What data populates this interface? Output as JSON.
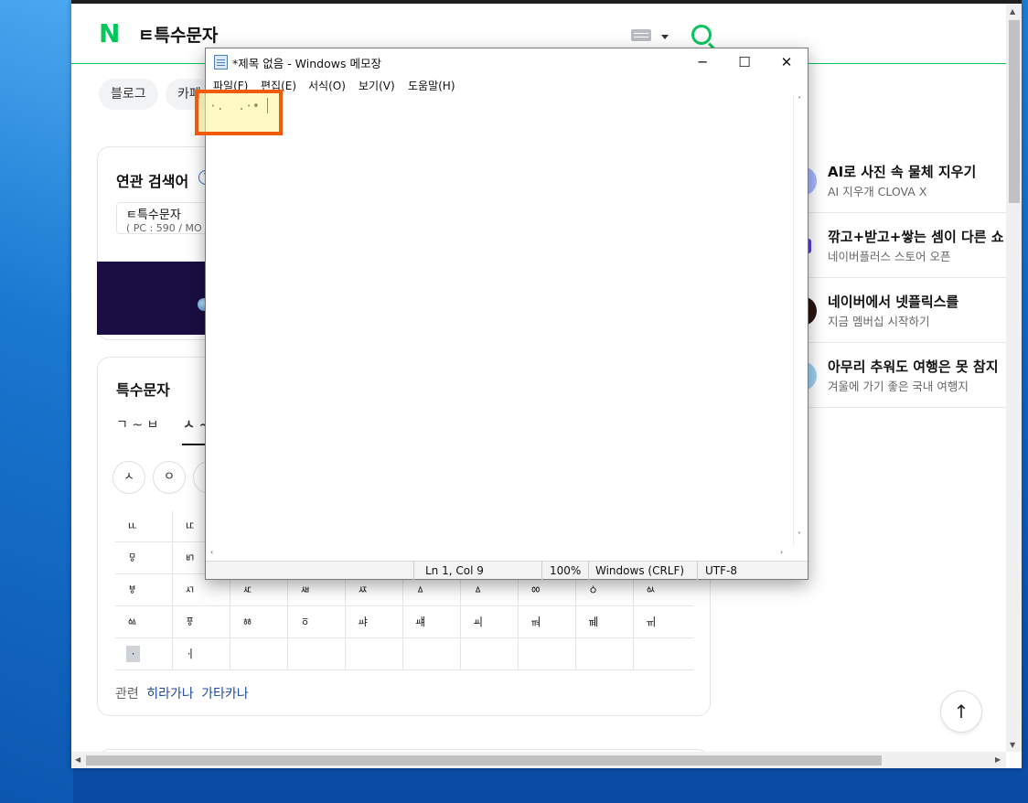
{
  "browser": {
    "query": "ㅌ특수문자",
    "tabs": [
      "블로그",
      "카페"
    ],
    "related": {
      "title": "연관 검색어",
      "help": "?",
      "keyword": "ㅌ특수문자",
      "count": "( PC : 590 / MO"
    },
    "special": {
      "title": "특수문자",
      "tabs": [
        "ㄱ ~ ㅂ",
        "ㅅ ~"
      ],
      "circles": [
        "ㅅ",
        "ㅇ"
      ],
      "grid": [
        [
          "ㅥ",
          "ㅦ",
          "",
          "",
          "",
          "",
          "",
          "",
          "",
          ""
        ],
        [
          "ㅱ",
          "ㅲ",
          "",
          "",
          "",
          "",
          "",
          "",
          "",
          ""
        ],
        [
          "ㅸ",
          "ㅺ",
          "ㅼ",
          "ㅽ",
          "ㅾ",
          "ㅿ",
          "ㅿ",
          "ㆀ",
          "ㆁ",
          "ㆂ"
        ],
        [
          "ㆃ",
          "ㆄ",
          "ㆅ",
          "ㆆ",
          "ㆇ",
          "ㆈ",
          "ㆉ",
          "ㆊ",
          "ㆋ",
          "ㆌ"
        ],
        [
          "ㆍ",
          "ㆎ",
          "",
          "",
          "",
          "",
          "",
          "",
          "",
          ""
        ]
      ],
      "related_label": "관련",
      "related_links": [
        "히라가나",
        "가타카나"
      ]
    },
    "sidebar": [
      {
        "title": "AI로 사진 속 물체 지우기",
        "sub": "AI 지우개 CLOVA X",
        "color": "#a8b6ff"
      },
      {
        "title": "깎고+받고+쌓는 셈이 다른 쇼",
        "sub": "네이버플러스 스토어 오픈",
        "color": "#5b3fd6"
      },
      {
        "title": "네이버에서 넷플릭스를",
        "sub": "지금 멤버십 시작하기",
        "color": "#2a1410"
      },
      {
        "title": "아무리 추워도 여행은 못 참지",
        "sub": "겨울에 가기 좋은 국내 여행지",
        "color": "#9fd0f0"
      }
    ],
    "top_button": "↑"
  },
  "notepad": {
    "title": "*제목 없음 - Windows 메모장",
    "menu": [
      "파일(F)",
      "편집(E)",
      "서식(O)",
      "보기(V)",
      "도움말(H)"
    ],
    "content": "·.  .·•",
    "status": {
      "position": "Ln 1, Col 9",
      "zoom": "100%",
      "line_ending": "Windows (CRLF)",
      "encoding": "UTF-8"
    },
    "controls": {
      "minimize": "─",
      "maximize": "☐",
      "close": "✕"
    }
  },
  "colors": {
    "naver_green": "#03c75a",
    "highlight_border": "#f05a0a",
    "link_blue": "#1f4aa3"
  }
}
